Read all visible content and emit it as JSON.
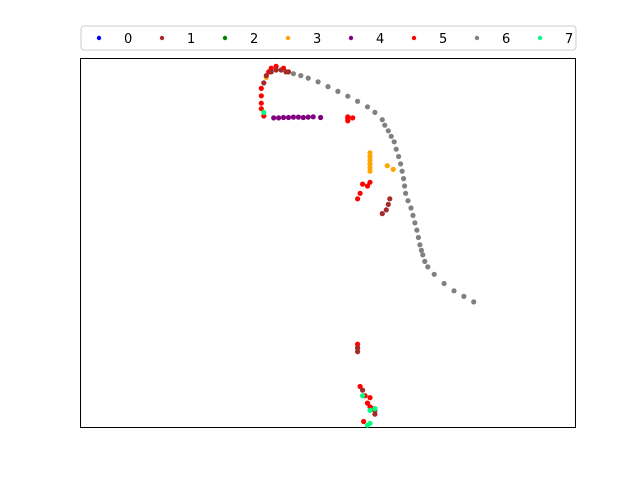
{
  "chart_data": {
    "type": "scatter",
    "title": "",
    "xlabel": "",
    "ylabel": "",
    "axes_visible": false,
    "grid": false,
    "legend_placement": "top-center",
    "legend": [
      {
        "label": "0",
        "color": "#0000ff"
      },
      {
        "label": "1",
        "color": "#a52a2a"
      },
      {
        "label": "2",
        "color": "#008000"
      },
      {
        "label": "3",
        "color": "#ffa500"
      },
      {
        "label": "4",
        "color": "#800080"
      },
      {
        "label": "5",
        "color": "#ff0000"
      },
      {
        "label": "6",
        "color": "#808080"
      },
      {
        "label": "7",
        "color": "#00ff7f"
      }
    ],
    "xlim": [
      0,
      100
    ],
    "ylim": [
      0,
      100
    ],
    "series": [
      {
        "name": "6",
        "x": [
          43.0,
          44.5,
          46.0,
          48.0,
          50.0,
          52.0,
          54.0,
          56.0,
          58.0,
          59.5,
          61.0,
          61.5,
          62.2,
          62.8,
          63.4,
          63.8,
          64.3,
          64.7,
          65.0,
          65.3,
          65.5,
          65.7,
          66.2,
          66.8,
          67.2,
          67.6,
          68.0,
          68.3,
          68.6,
          68.9,
          69.2,
          69.6,
          70.2,
          71.5,
          73.5,
          75.5,
          77.5,
          79.5
        ],
        "y": [
          96.0,
          95.5,
          94.8,
          93.8,
          92.5,
          91.2,
          89.9,
          88.5,
          87.0,
          85.5,
          83.5,
          82.0,
          80.5,
          79.0,
          77.5,
          75.5,
          73.5,
          71.5,
          69.5,
          67.5,
          65.5,
          63.5,
          61.5,
          59.5,
          57.5,
          55.5,
          53.5,
          51.5,
          49.5,
          48.0,
          46.8,
          45.0,
          43.5,
          41.5,
          39.0,
          37.0,
          35.5,
          34.0
        ]
      },
      {
        "name": "3",
        "x": [
          37.5,
          58.5,
          58.5,
          58.5,
          58.5,
          58.5,
          58.5,
          62.0,
          63.2
        ],
        "y": [
          95.0,
          74.5,
          73.5,
          72.5,
          71.5,
          70.5,
          69.5,
          71.0,
          70.0
        ]
      },
      {
        "name": "5",
        "x": [
          38.0,
          38.5,
          39.5,
          41.0,
          36.5,
          36.5,
          36.5,
          36.5,
          37.0,
          54.0,
          54.0,
          54.0,
          54.0,
          55.0,
          56.5,
          58.5,
          56.0,
          57.0,
          58.0,
          56.0,
          56.0,
          56.5,
          57.5,
          58.5,
          58.0,
          58.5,
          59.0,
          57.2
        ],
        "y": [
          96.5,
          97.5,
          98.0,
          97.5,
          92.0,
          90.0,
          88.0,
          86.5,
          84.5,
          84.3,
          84.0,
          83.5,
          83.2,
          84.0,
          63.5,
          66.5,
          62.0,
          66.0,
          65.5,
          22.5,
          21.5,
          11.0,
          8.5,
          8.0,
          6.5,
          5.5,
          5.0,
          1.5
        ]
      },
      {
        "name": "1",
        "x": [
          37.0,
          37.5,
          38.5,
          39.5,
          40.5,
          41.5,
          42.0,
          62.5,
          62.2,
          61.8,
          61.0,
          56.0,
          56.0,
          57.0,
          59.5,
          59.5
        ],
        "y": [
          93.5,
          95.5,
          96.5,
          97.0,
          97.0,
          96.5,
          96.5,
          62.0,
          60.5,
          59.0,
          58.0,
          21.5,
          20.5,
          10.0,
          4.5,
          3.5
        ]
      },
      {
        "name": "4",
        "x": [
          39.0,
          40.0,
          41.0,
          42.0,
          43.0,
          44.0,
          45.0,
          46.0,
          47.0,
          48.5
        ],
        "y": [
          84.0,
          84.0,
          84.1,
          84.1,
          84.2,
          84.2,
          84.1,
          84.2,
          84.3,
          84.1
        ]
      },
      {
        "name": "7",
        "x": [
          37.0,
          57.0,
          58.5,
          59.5,
          58.5,
          58.0
        ],
        "y": [
          85.5,
          8.5,
          4.5,
          5.0,
          1.0,
          0.5
        ]
      }
    ]
  }
}
